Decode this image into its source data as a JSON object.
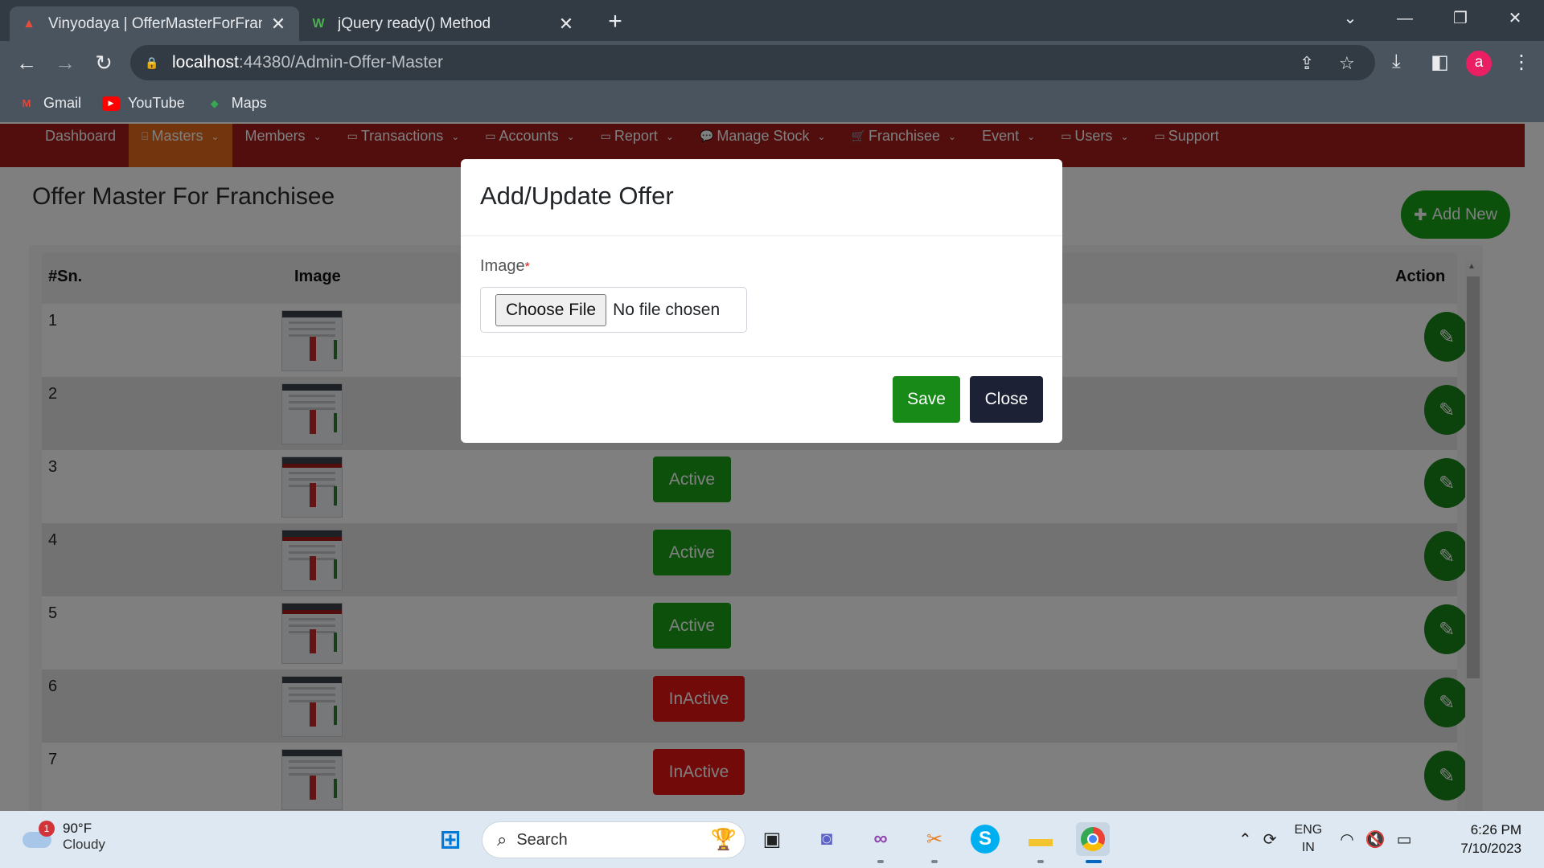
{
  "browser": {
    "tabs": [
      {
        "title": "Vinyodaya | OfferMasterForFranc",
        "favicon": "vinyodaya-icon",
        "active": true
      },
      {
        "title": "jQuery ready() Method",
        "favicon": "w3schools-icon",
        "active": false
      }
    ],
    "new_tab": "+",
    "url_host": "localhost",
    "url_path": ":44380/Admin-Offer-Master",
    "avatar_letter": "a",
    "bookmarks": [
      {
        "label": "Gmail",
        "icon": "gmail-icon"
      },
      {
        "label": "YouTube",
        "icon": "youtube-icon"
      },
      {
        "label": "Maps",
        "icon": "maps-icon"
      }
    ]
  },
  "nav": {
    "items": [
      {
        "label": "Dashboard",
        "icon": "",
        "dropdown": false,
        "active": false
      },
      {
        "label": "Masters",
        "icon": "⌸",
        "dropdown": true,
        "active": true
      },
      {
        "label": "Members",
        "icon": "",
        "dropdown": true,
        "active": false
      },
      {
        "label": "Transactions",
        "icon": "▭",
        "dropdown": true,
        "active": false
      },
      {
        "label": "Accounts",
        "icon": "▭",
        "dropdown": true,
        "active": false
      },
      {
        "label": "Report",
        "icon": "▭",
        "dropdown": true,
        "active": false
      },
      {
        "label": "Manage Stock",
        "icon": "💬",
        "dropdown": true,
        "active": false
      },
      {
        "label": "Franchisee",
        "icon": "🛒",
        "dropdown": true,
        "active": false
      },
      {
        "label": "Event",
        "icon": "",
        "dropdown": true,
        "active": false
      },
      {
        "label": "Users",
        "icon": "▭",
        "dropdown": true,
        "active": false
      },
      {
        "label": "Support",
        "icon": "▭",
        "dropdown": false,
        "active": false
      }
    ]
  },
  "page": {
    "title": "Offer Master For Franchisee",
    "add_new_label": "Add New"
  },
  "table": {
    "headers": {
      "sn": "#Sn.",
      "image": "Image",
      "action": "Action"
    },
    "rows": [
      {
        "sn": "1",
        "status": ""
      },
      {
        "sn": "2",
        "status": ""
      },
      {
        "sn": "3",
        "status": "Active"
      },
      {
        "sn": "4",
        "status": "Active"
      },
      {
        "sn": "5",
        "status": "Active"
      },
      {
        "sn": "6",
        "status": "InActive"
      },
      {
        "sn": "7",
        "status": "InActive"
      }
    ]
  },
  "modal": {
    "title": "Add/Update Offer",
    "image_label": "Image",
    "required_mark": "*",
    "choose_file_label": "Choose File",
    "no_file_text": "No file chosen",
    "save_label": "Save",
    "close_label": "Close"
  },
  "taskbar": {
    "weather_temp": "90°F",
    "weather_condition": "Cloudy",
    "weather_badge": "1",
    "search_placeholder": "Search",
    "lang_top": "ENG",
    "lang_bottom": "IN",
    "time": "6:26 PM",
    "date": "7/10/2023"
  },
  "colors": {
    "menubar": "#a41a1a",
    "menu_active": "#e56a1d",
    "active_green": "#18a018",
    "inactive_red": "#e41414",
    "save_green": "#178a17",
    "close_navy": "#1c2135"
  }
}
